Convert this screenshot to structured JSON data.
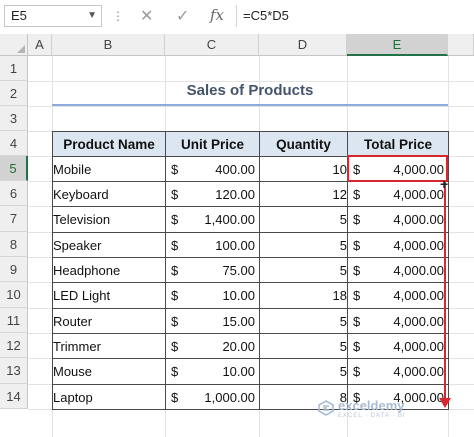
{
  "formula_bar": {
    "name_box": "E5",
    "formula": "=C5*D5",
    "fx_label": "fx"
  },
  "columns": [
    "A",
    "B",
    "C",
    "D",
    "E"
  ],
  "rows": [
    "1",
    "2",
    "3",
    "4",
    "5",
    "6",
    "7",
    "8",
    "9",
    "10",
    "11",
    "12",
    "13",
    "14"
  ],
  "sheet": {
    "title": "Sales of Products",
    "headers": [
      "Product Name",
      "Unit Price",
      "Quantity",
      "Total Price"
    ],
    "currency_symbol": "$",
    "data": [
      {
        "name": "Mobile",
        "unit_price": "400.00",
        "qty": "10",
        "total": "4,000.00"
      },
      {
        "name": "Keyboard",
        "unit_price": "120.00",
        "qty": "12",
        "total": "4,000.00"
      },
      {
        "name": "Television",
        "unit_price": "1,400.00",
        "qty": "5",
        "total": "4,000.00"
      },
      {
        "name": "Speaker",
        "unit_price": "100.00",
        "qty": "5",
        "total": "4,000.00"
      },
      {
        "name": "Headphone",
        "unit_price": "75.00",
        "qty": "5",
        "total": "4,000.00"
      },
      {
        "name": "LED Light",
        "unit_price": "10.00",
        "qty": "18",
        "total": "4,000.00"
      },
      {
        "name": "Router",
        "unit_price": "15.00",
        "qty": "5",
        "total": "4,000.00"
      },
      {
        "name": "Trimmer",
        "unit_price": "20.00",
        "qty": "5",
        "total": "4,000.00"
      },
      {
        "name": "Mouse",
        "unit_price": "10.00",
        "qty": "5",
        "total": "4,000.00"
      },
      {
        "name": "Laptop",
        "unit_price": "1,000.00",
        "qty": "8",
        "total": "4,000.00"
      }
    ]
  },
  "selection": {
    "cell": "E5",
    "accent": "#217346",
    "highlight": "#d9262e"
  },
  "watermark": {
    "name": "exceldemy",
    "tagline": "EXCEL · DATA · BI"
  }
}
